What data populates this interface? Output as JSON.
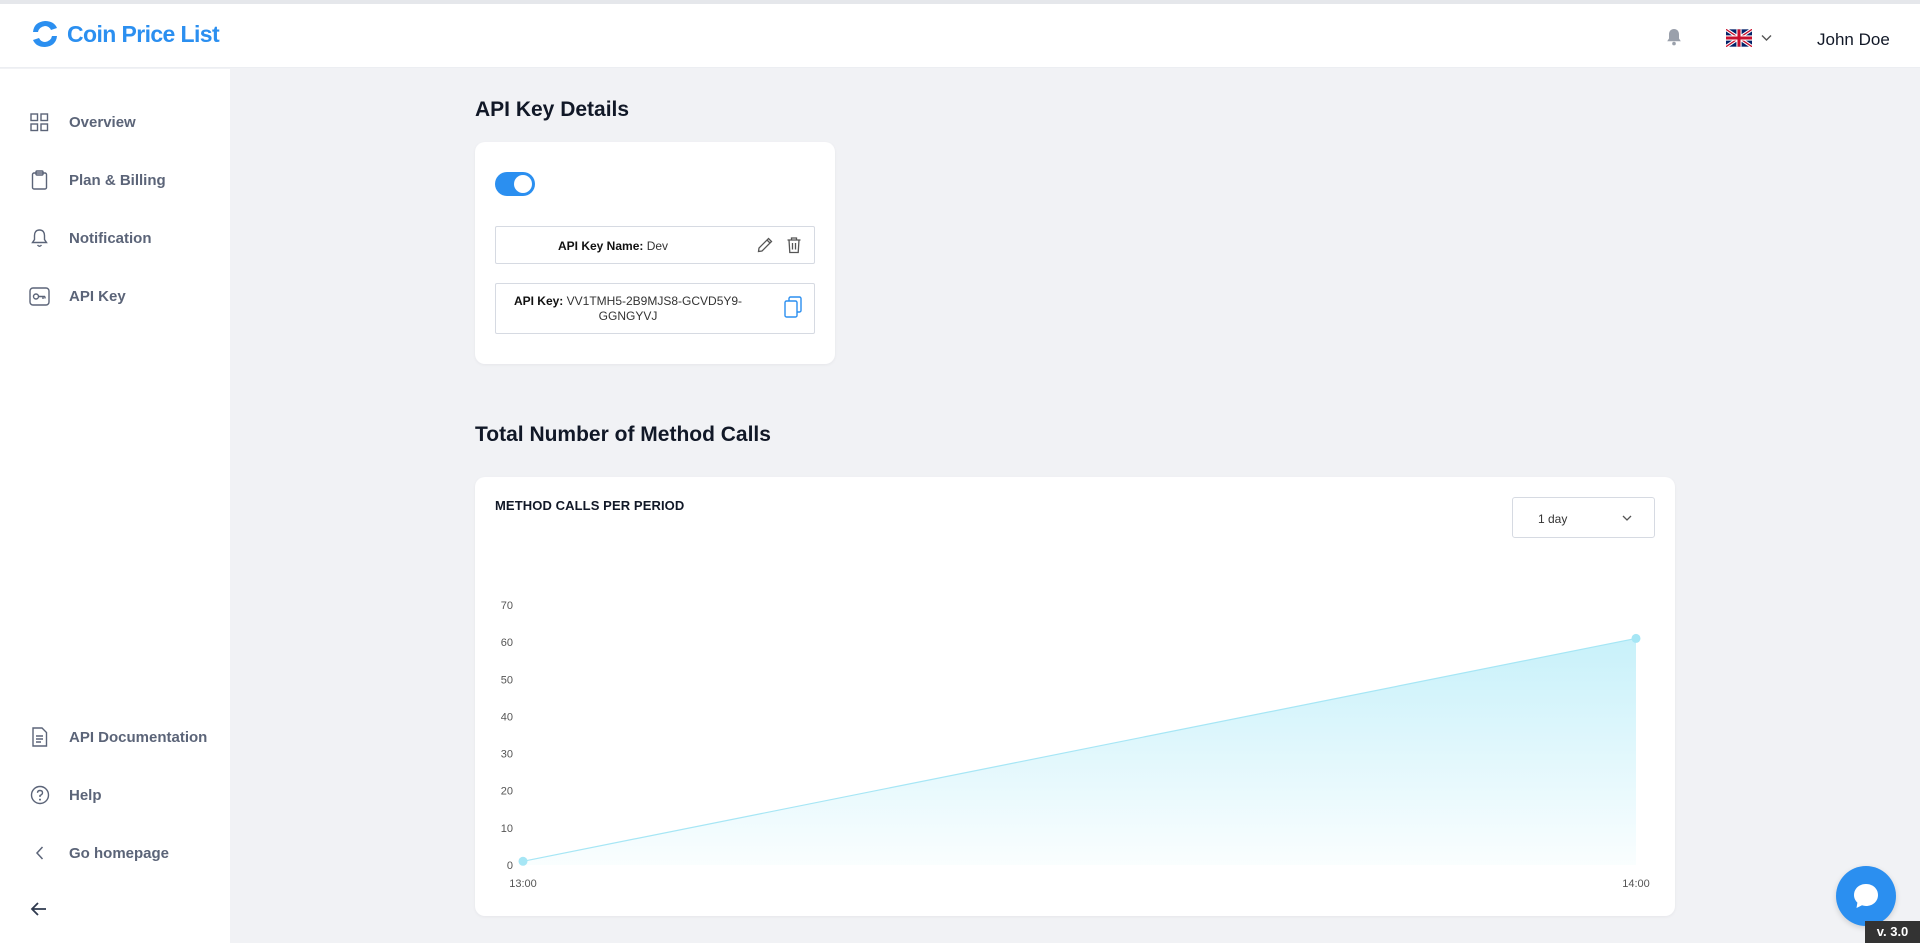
{
  "app": {
    "title": "Coin Price List"
  },
  "header": {
    "user_name": "John Doe",
    "language": "English (UK)"
  },
  "sidebar": {
    "items": [
      {
        "label": "Overview",
        "icon": "grid-icon"
      },
      {
        "label": "Plan & Billing",
        "icon": "clipboard-icon"
      },
      {
        "label": "Notification",
        "icon": "bell-icon"
      },
      {
        "label": "API Key",
        "icon": "key-icon"
      }
    ],
    "bottom_items": [
      {
        "label": "API Documentation",
        "icon": "document-icon"
      },
      {
        "label": "Help",
        "icon": "help-icon"
      },
      {
        "label": "Go homepage",
        "icon": "chevron-left-icon"
      }
    ]
  },
  "api_details": {
    "title": "API Key Details",
    "enabled": true,
    "name_label": "API Key Name:",
    "name_value": "Dev",
    "key_label": "API Key:",
    "key_value": "VV1TMH5-2B9MJS8-GCVD5Y9-GGNGYVJ"
  },
  "method_calls": {
    "title": "Total Number of Method Calls",
    "chart_title": "METHOD CALLS PER PERIOD",
    "period": "1 day"
  },
  "chart_data": {
    "type": "area",
    "title": "METHOD CALLS PER PERIOD",
    "x": [
      "13:00",
      "14:00"
    ],
    "values": [
      1,
      61
    ],
    "yticks": [
      0,
      10,
      20,
      30,
      40,
      50,
      60,
      70
    ],
    "ylim": [
      0,
      70
    ],
    "grid": false,
    "color": "#c8f1fa"
  },
  "footer": {
    "version": "v. 3.0"
  },
  "colors": {
    "accent": "#2b8ff0",
    "area": "#c8f1fa",
    "line": "#a6e6f5"
  }
}
